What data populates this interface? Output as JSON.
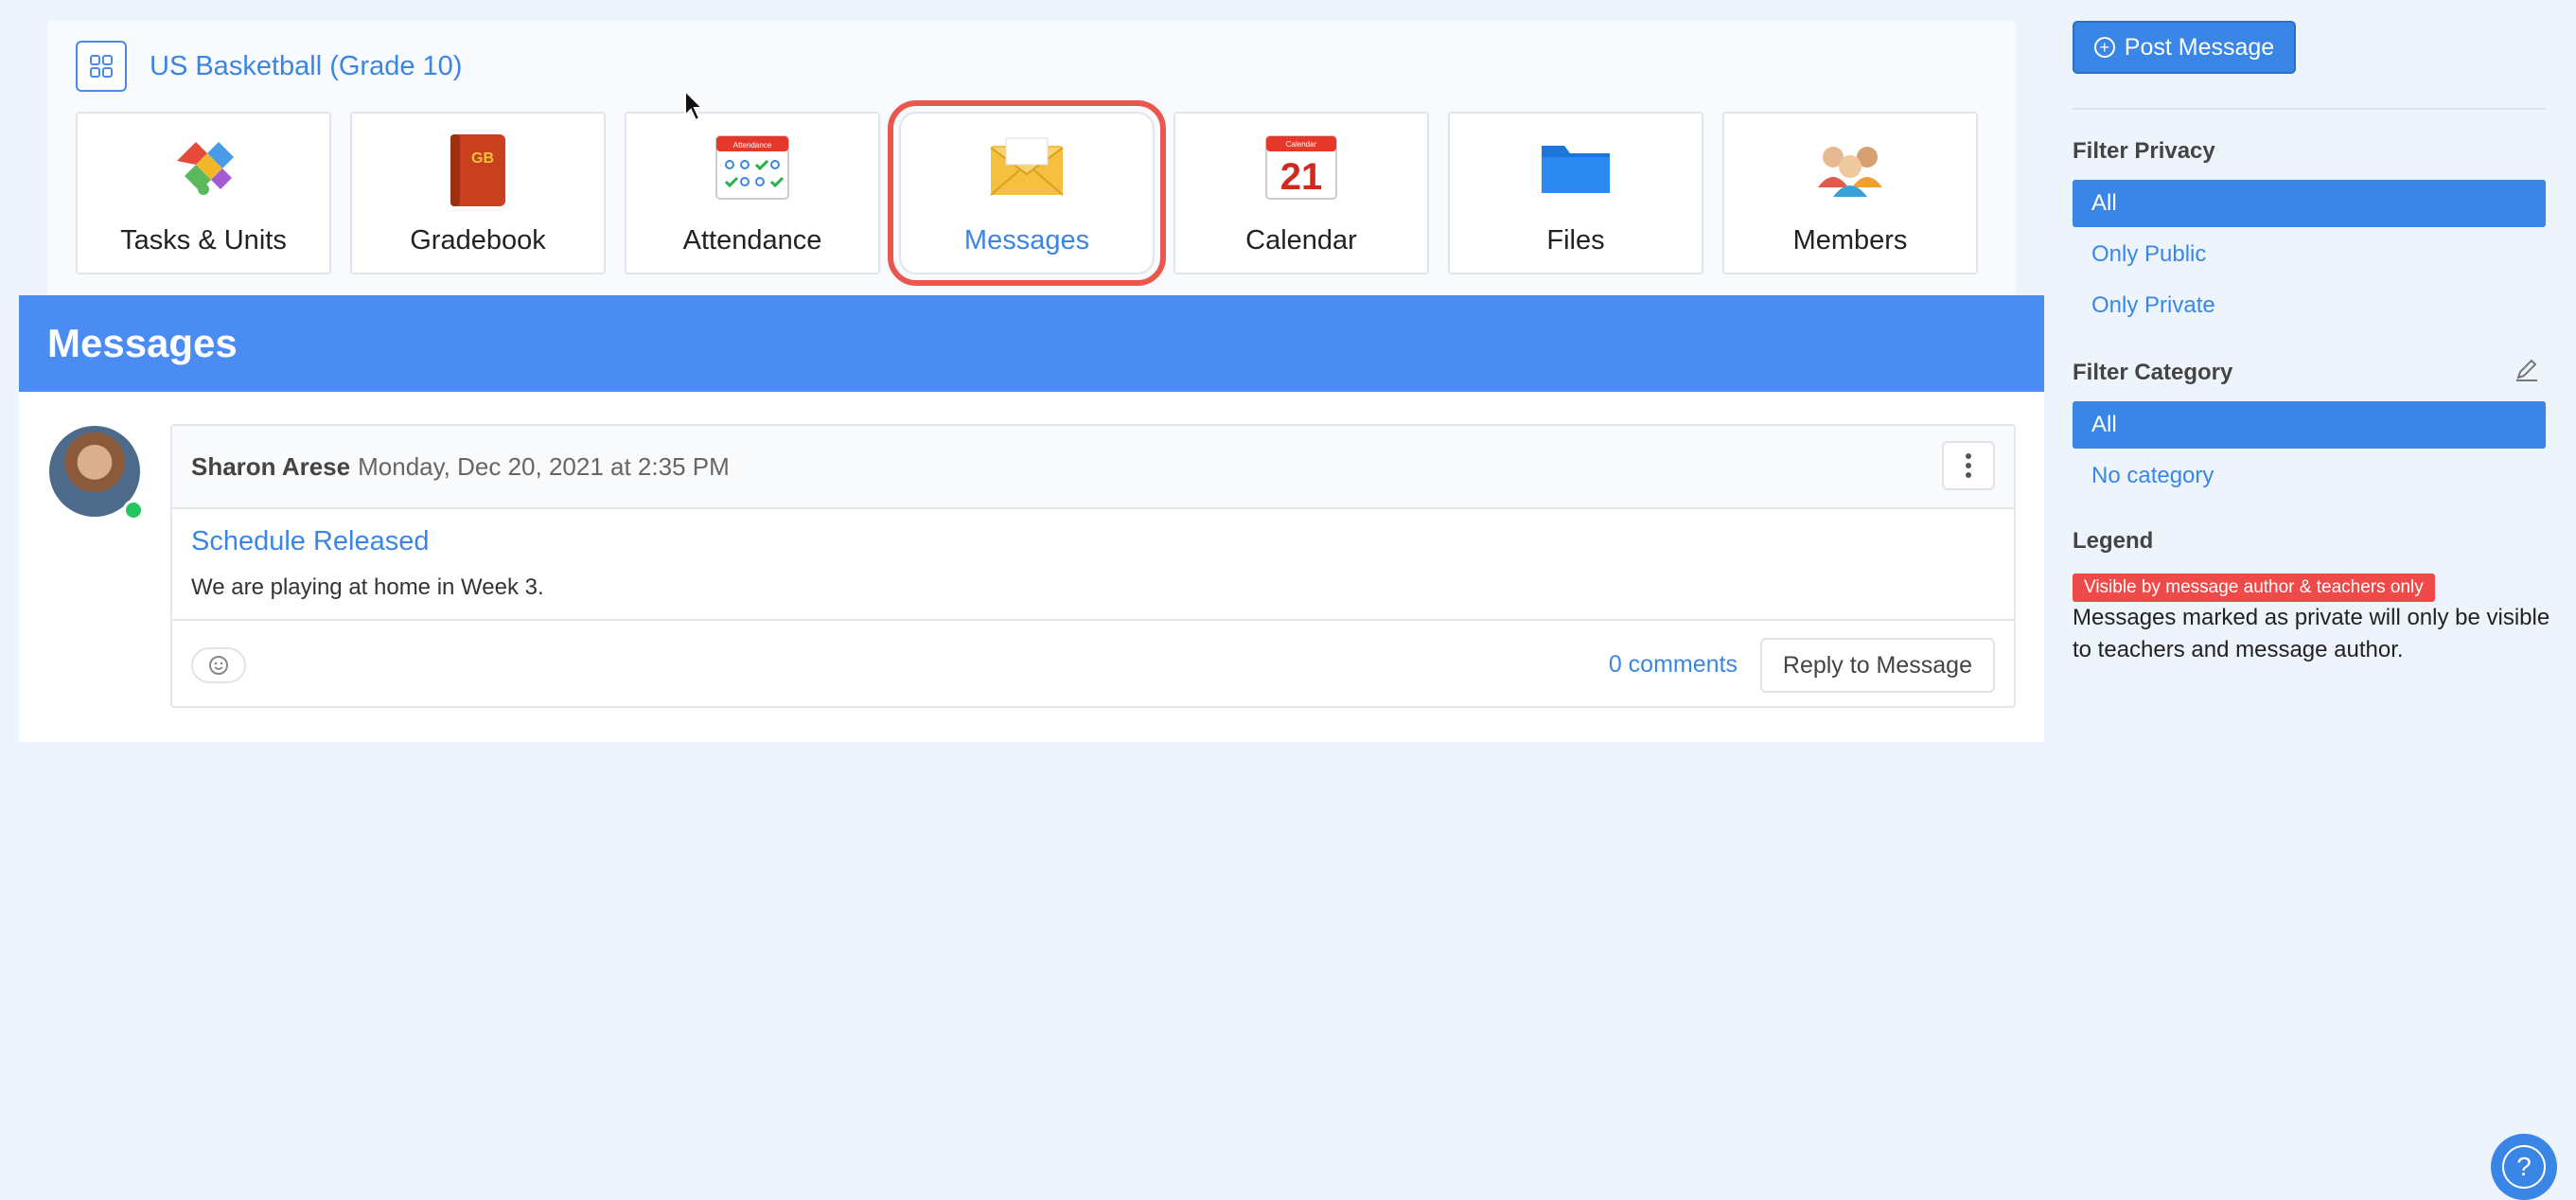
{
  "class": {
    "title": "US Basketball (Grade 10)",
    "icon": "grid-icon"
  },
  "tiles": [
    {
      "label": "Tasks & Units",
      "icon": "puzzle-icon"
    },
    {
      "label": "Gradebook",
      "icon": "gradebook-icon",
      "icon_text": "GB"
    },
    {
      "label": "Attendance",
      "icon": "attendance-icon",
      "icon_text": "Attendance"
    },
    {
      "label": "Messages",
      "icon": "envelope-icon",
      "active": true
    },
    {
      "label": "Calendar",
      "icon": "calendar-icon",
      "icon_text": "21",
      "icon_header": "Calendar"
    },
    {
      "label": "Files",
      "icon": "folder-icon"
    },
    {
      "label": "Members",
      "icon": "members-icon"
    }
  ],
  "messages": {
    "banner_title": "Messages",
    "items": [
      {
        "author": "Sharon Arese",
        "date": "Monday, Dec 20, 2021 at 2:35 PM",
        "title": "Schedule Released",
        "body": "We are playing at home in Week 3.",
        "comments": "0 comments",
        "reply_label": "Reply to Message"
      }
    ]
  },
  "sidebar": {
    "post_label": "Post Message",
    "privacy": {
      "heading": "Filter Privacy",
      "options": [
        "All",
        "Only Public",
        "Only Private"
      ],
      "selected": "All"
    },
    "category": {
      "heading": "Filter Category",
      "options": [
        "All",
        "No category"
      ],
      "selected": "All"
    },
    "legend": {
      "heading": "Legend",
      "badge": "Visible by message author & teachers only",
      "text": "Messages marked as private will only be visible to teachers and message author."
    }
  },
  "colors": {
    "accent": "#3a86e6",
    "banner": "#4a8cf2",
    "highlight": "#e9574d",
    "private_badge": "#ef4a4a",
    "online": "#25c45f"
  }
}
